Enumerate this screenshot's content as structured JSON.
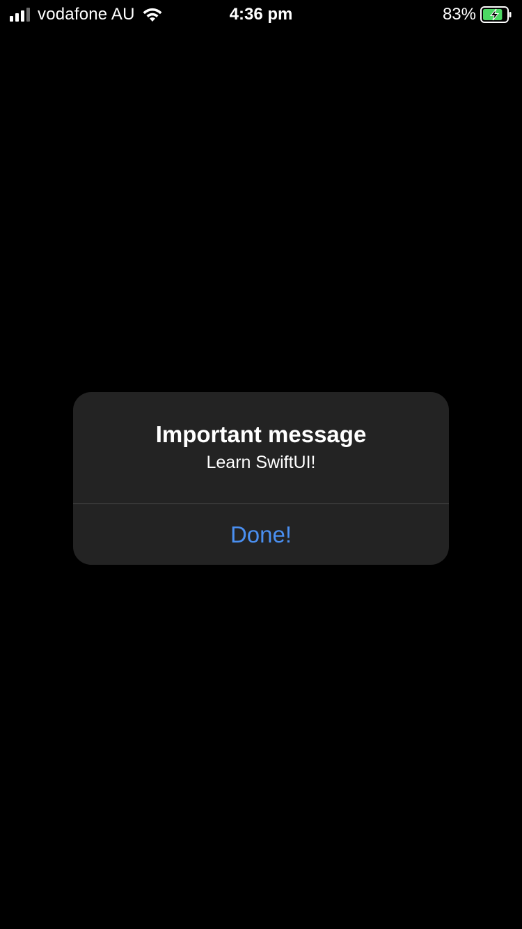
{
  "status_bar": {
    "carrier": "vodafone AU",
    "time": "4:36 pm",
    "battery_percent": "83%",
    "battery_level": 0.83,
    "charging": true,
    "signal_bars_filled": 3,
    "signal_bars_total": 4,
    "icons": {
      "signal": "cellular-signal-icon",
      "wifi": "wifi-icon",
      "battery": "battery-charging-icon"
    }
  },
  "alert": {
    "title": "Important message",
    "message": "Learn SwiftUI!",
    "button_label": "Done!"
  },
  "colors": {
    "background": "#000000",
    "alert_background": "#232323",
    "accent": "#4a8ff0",
    "battery_fill": "#4cd964"
  }
}
